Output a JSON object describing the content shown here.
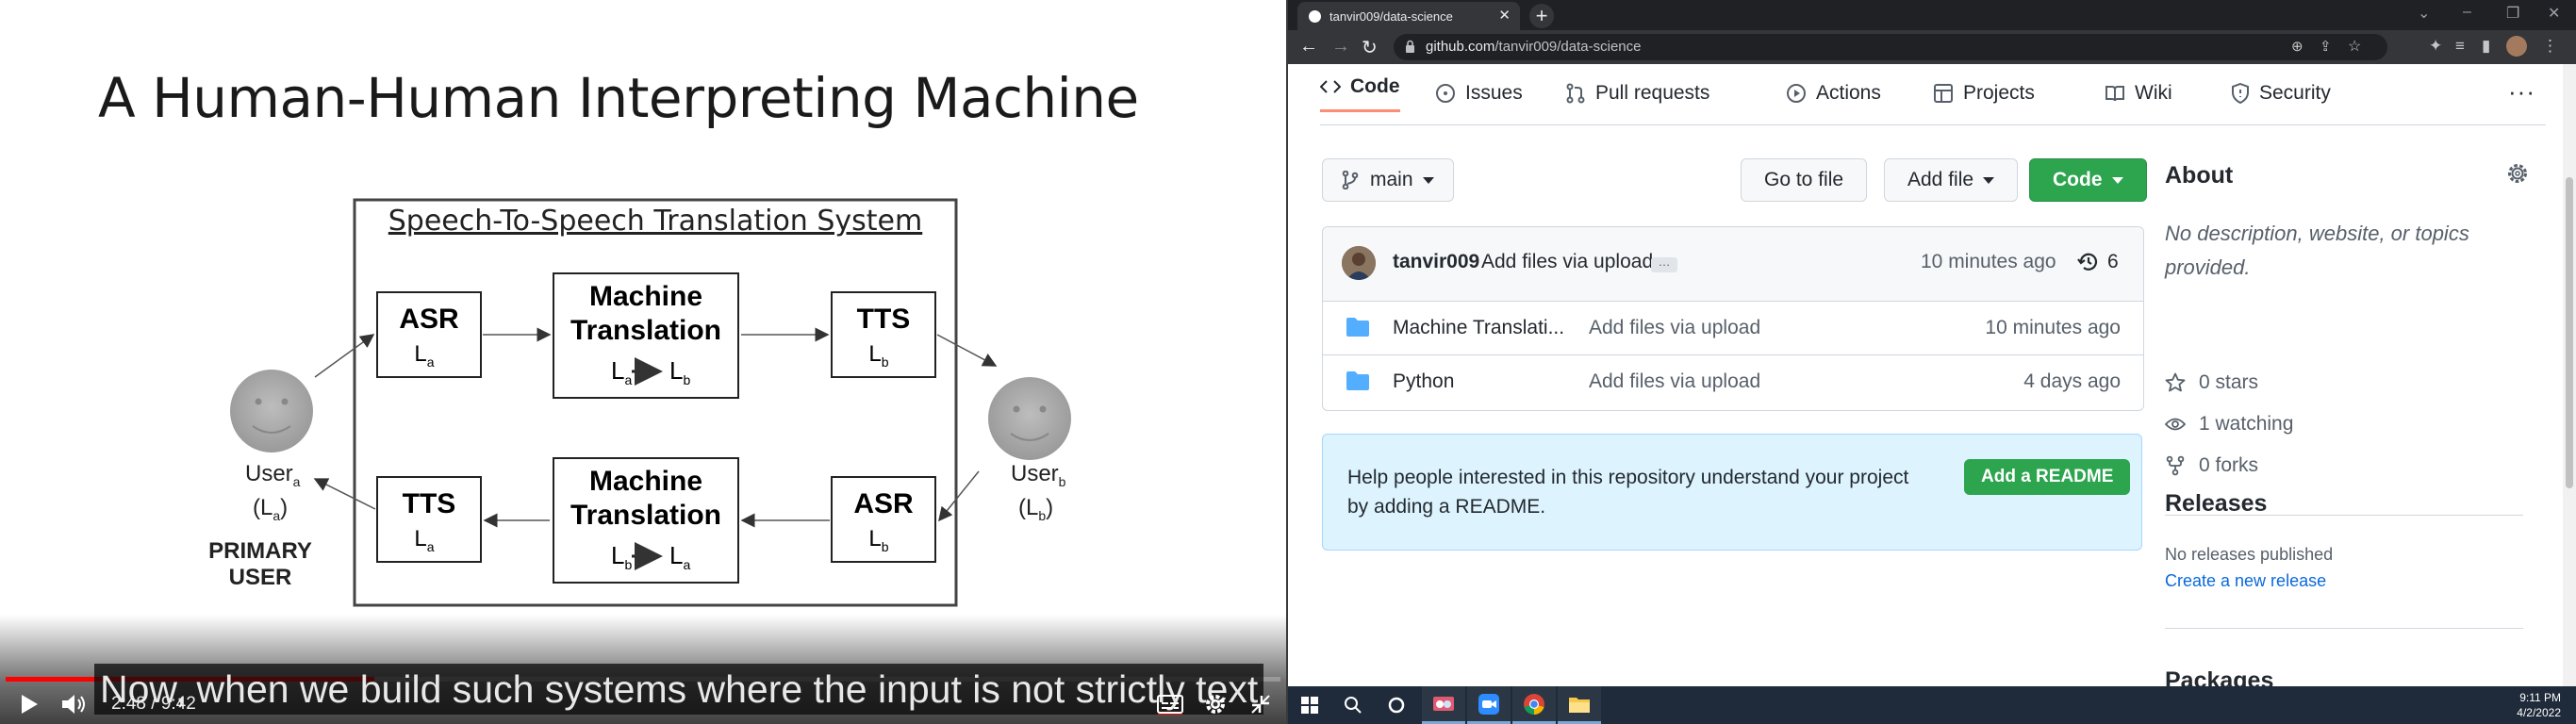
{
  "video": {
    "slide": {
      "title": "A Human-Human Interpreting Machine",
      "system_title": "Speech-To-Speech Translation System",
      "top_row": [
        {
          "label": "ASR",
          "sub": "L",
          "subscript": "a"
        },
        {
          "label": "Machine Translation",
          "from": "L",
          "from_sub": "a",
          "to": "L",
          "to_sub": "b"
        },
        {
          "label": "TTS",
          "sub": "L",
          "subscript": "b"
        }
      ],
      "bottom_row": [
        {
          "label": "TTS",
          "sub": "L",
          "subscript": "a"
        },
        {
          "label": "Machine Translation",
          "from": "L",
          "from_sub": "b",
          "to": "L",
          "to_sub": "a"
        },
        {
          "label": "ASR",
          "sub": "L",
          "subscript": "b"
        }
      ],
      "user_a": {
        "label": "User",
        "sub": "a",
        "lang": "(L",
        "lang_sub": "a",
        "lang_end": ")"
      },
      "user_b": {
        "label": "User",
        "sub": "b",
        "lang": "(L",
        "lang_sub": "b",
        "lang_end": ")"
      },
      "primary_user": [
        "PRIMARY",
        "USER"
      ]
    },
    "caption": "Now, when we build such systems where the input is not strictly text",
    "current_time": "2:48",
    "separator": "/",
    "duration": "9:42",
    "progress": 0.289,
    "colors": {
      "progress": "#ff0000"
    }
  },
  "browser": {
    "tab_title": "tanvir009/data-science",
    "url_host": "github.com",
    "url_path": "/tanvir009/data-science",
    "icons": [
      "back-icon",
      "forward-icon",
      "reload-icon",
      "lock-icon",
      "zoom-icon",
      "share-icon",
      "star-icon",
      "extensions-icon",
      "media-icon",
      "sidepanel-icon",
      "profile-avatar",
      "menu-icon"
    ]
  },
  "github": {
    "nav": {
      "code": "Code",
      "issues": "Issues",
      "pull_requests": "Pull requests",
      "actions": "Actions",
      "projects": "Projects",
      "wiki": "Wiki",
      "security": "Security",
      "more": "···"
    },
    "branch": "main",
    "go_to_file": "Go to file",
    "add_file": "Add file",
    "code_button": "Code",
    "commit": {
      "author": "tanvir009",
      "message": "Add files via upload",
      "ellipsis": "…",
      "time": "10 minutes ago",
      "count": "6"
    },
    "files": [
      {
        "name": "Machine Translati...",
        "commit": "Add files via upload",
        "time": "10 minutes ago"
      },
      {
        "name": "Python",
        "commit": "Add files via upload",
        "time": "4 days ago"
      }
    ],
    "readme": {
      "text": "Help people interested in this repository understand your project by adding a README.",
      "button": "Add a README"
    },
    "about": {
      "title": "About",
      "description": "No description, website, or topics provided.",
      "stars": "0 stars",
      "watching": "1 watching",
      "forks": "0 forks"
    },
    "releases": {
      "title": "Releases",
      "none": "No releases published",
      "link": "Create a new release"
    },
    "packages_title": "Packages",
    "colors": {
      "green": "#2da44e",
      "link": "#0969da",
      "readme_bg": "#ddf4ff"
    }
  },
  "taskbar": {
    "time": "9:11 PM",
    "date": "4/2/2022"
  }
}
